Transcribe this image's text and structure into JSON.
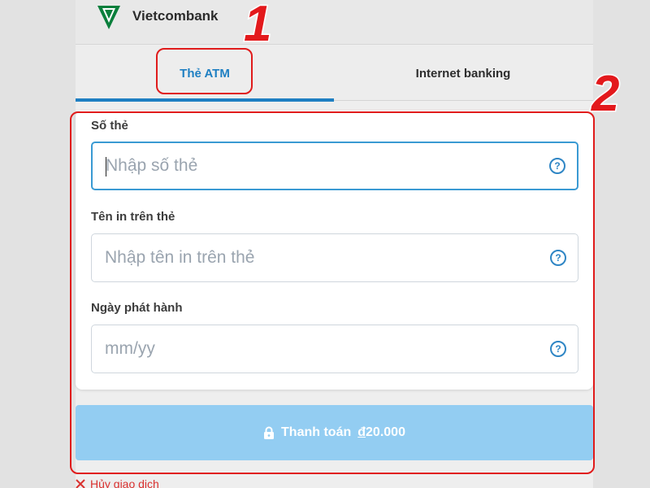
{
  "bank": {
    "name": "Vietcombank",
    "logo_icon": "vietcombank-logo-icon",
    "brand_color": "#0a7f3c"
  },
  "tabs": [
    {
      "label": "Thẻ ATM",
      "active": true
    },
    {
      "label": "Internet banking",
      "active": false
    }
  ],
  "form": {
    "card_number": {
      "label": "Số thẻ",
      "placeholder": "Nhập số thẻ"
    },
    "card_name": {
      "label": "Tên in trên thẻ",
      "placeholder": "Nhập tên in trên thẻ"
    },
    "issue_date": {
      "label": "Ngày phát hành",
      "placeholder": "mm/yy"
    },
    "help_icon": "question-circle-icon"
  },
  "pay_button": {
    "label": "Thanh toán",
    "currency_symbol": "đ",
    "amount": "20.000"
  },
  "cancel": {
    "label": "Hủy giao dịch"
  },
  "annotations": {
    "one": "1",
    "two": "2"
  },
  "colors": {
    "accent": "#1e7fc2",
    "annotation": "#e01b1b",
    "pay_button": "#93cdf2",
    "cancel": "#d9312f"
  }
}
